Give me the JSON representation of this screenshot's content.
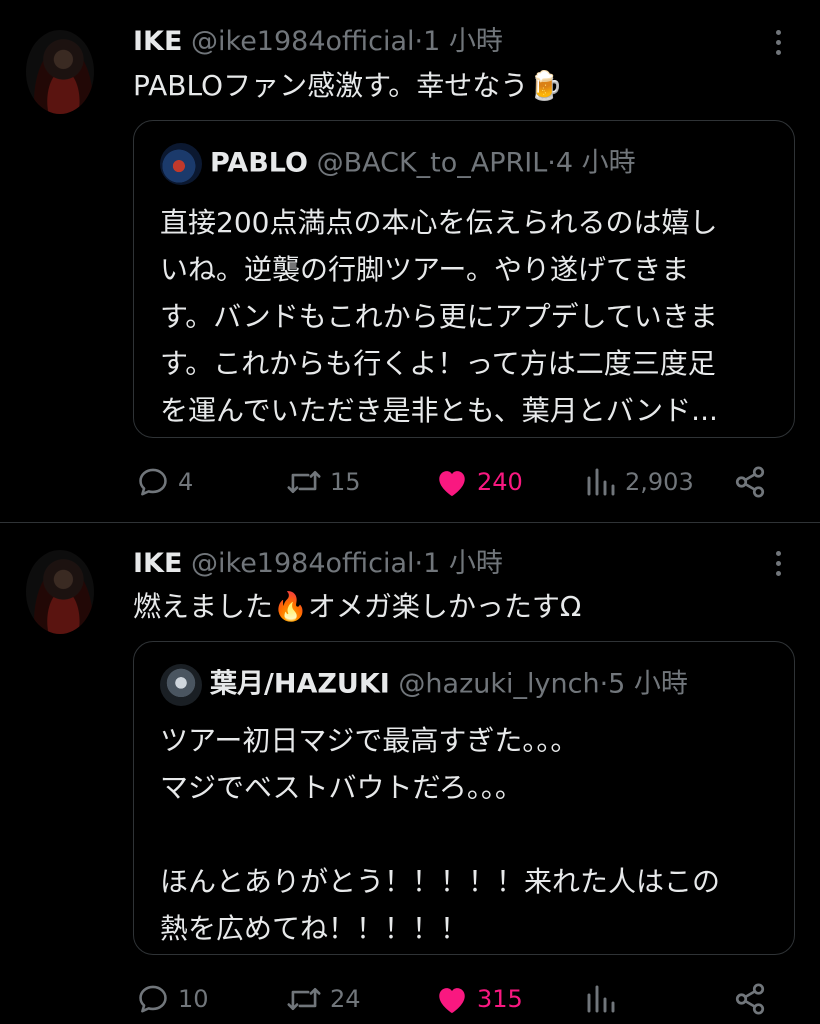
{
  "tweets": [
    {
      "author_name": "IKE",
      "handle": "@ike1984official",
      "dot": "·",
      "time": "1 小時",
      "text": "PABLOファン感激す。幸せなう🍺",
      "quote": {
        "name": "PABLO",
        "handle": "@BACK_to_APRIL",
        "dot": "·",
        "time": "4 小時",
        "lines": [
          "直接200点満点の本心を伝えられるのは嬉し",
          "いね。逆襲の行脚ツアー。やり遂げてきま",
          "す。バンドもこれから更にアプデしていきま",
          "す。これからも行くよ！って方は二度三度足",
          "を運んでいただき是非とも、葉月とバンド..."
        ]
      },
      "actions": {
        "replies": "4",
        "reposts": "15",
        "likes": "240",
        "views": "2,903"
      }
    },
    {
      "author_name": "IKE",
      "handle": "@ike1984official",
      "dot": "·",
      "time": "1 小時",
      "text": "燃えました🔥オメガ楽しかったすΩ",
      "quote": {
        "name": "葉月/HAZUKI",
        "handle": "@hazuki_lynch",
        "dot": "·",
        "time": "5 小時",
        "lines": [
          "ツアー初日マジで最高すぎた。。。",
          "マジでベストバウトだろ。。。",
          "",
          "ほんとありがとう！！！！！来れた人はこの",
          "熱を広めてね！！！！！"
        ]
      },
      "actions": {
        "replies": "10",
        "reposts": "24",
        "likes": "315",
        "views": ""
      }
    }
  ],
  "icons": {
    "reply": "speech-bubble",
    "repost": "repost-arrows",
    "like": "heart-filled",
    "views": "bar-chart",
    "share": "share-nodes",
    "more": "vertical-dots"
  },
  "colors": {
    "background": "#000000",
    "text": "#e7e9ea",
    "muted": "#71767b",
    "like": "#f91880",
    "border": "#2f3336"
  }
}
